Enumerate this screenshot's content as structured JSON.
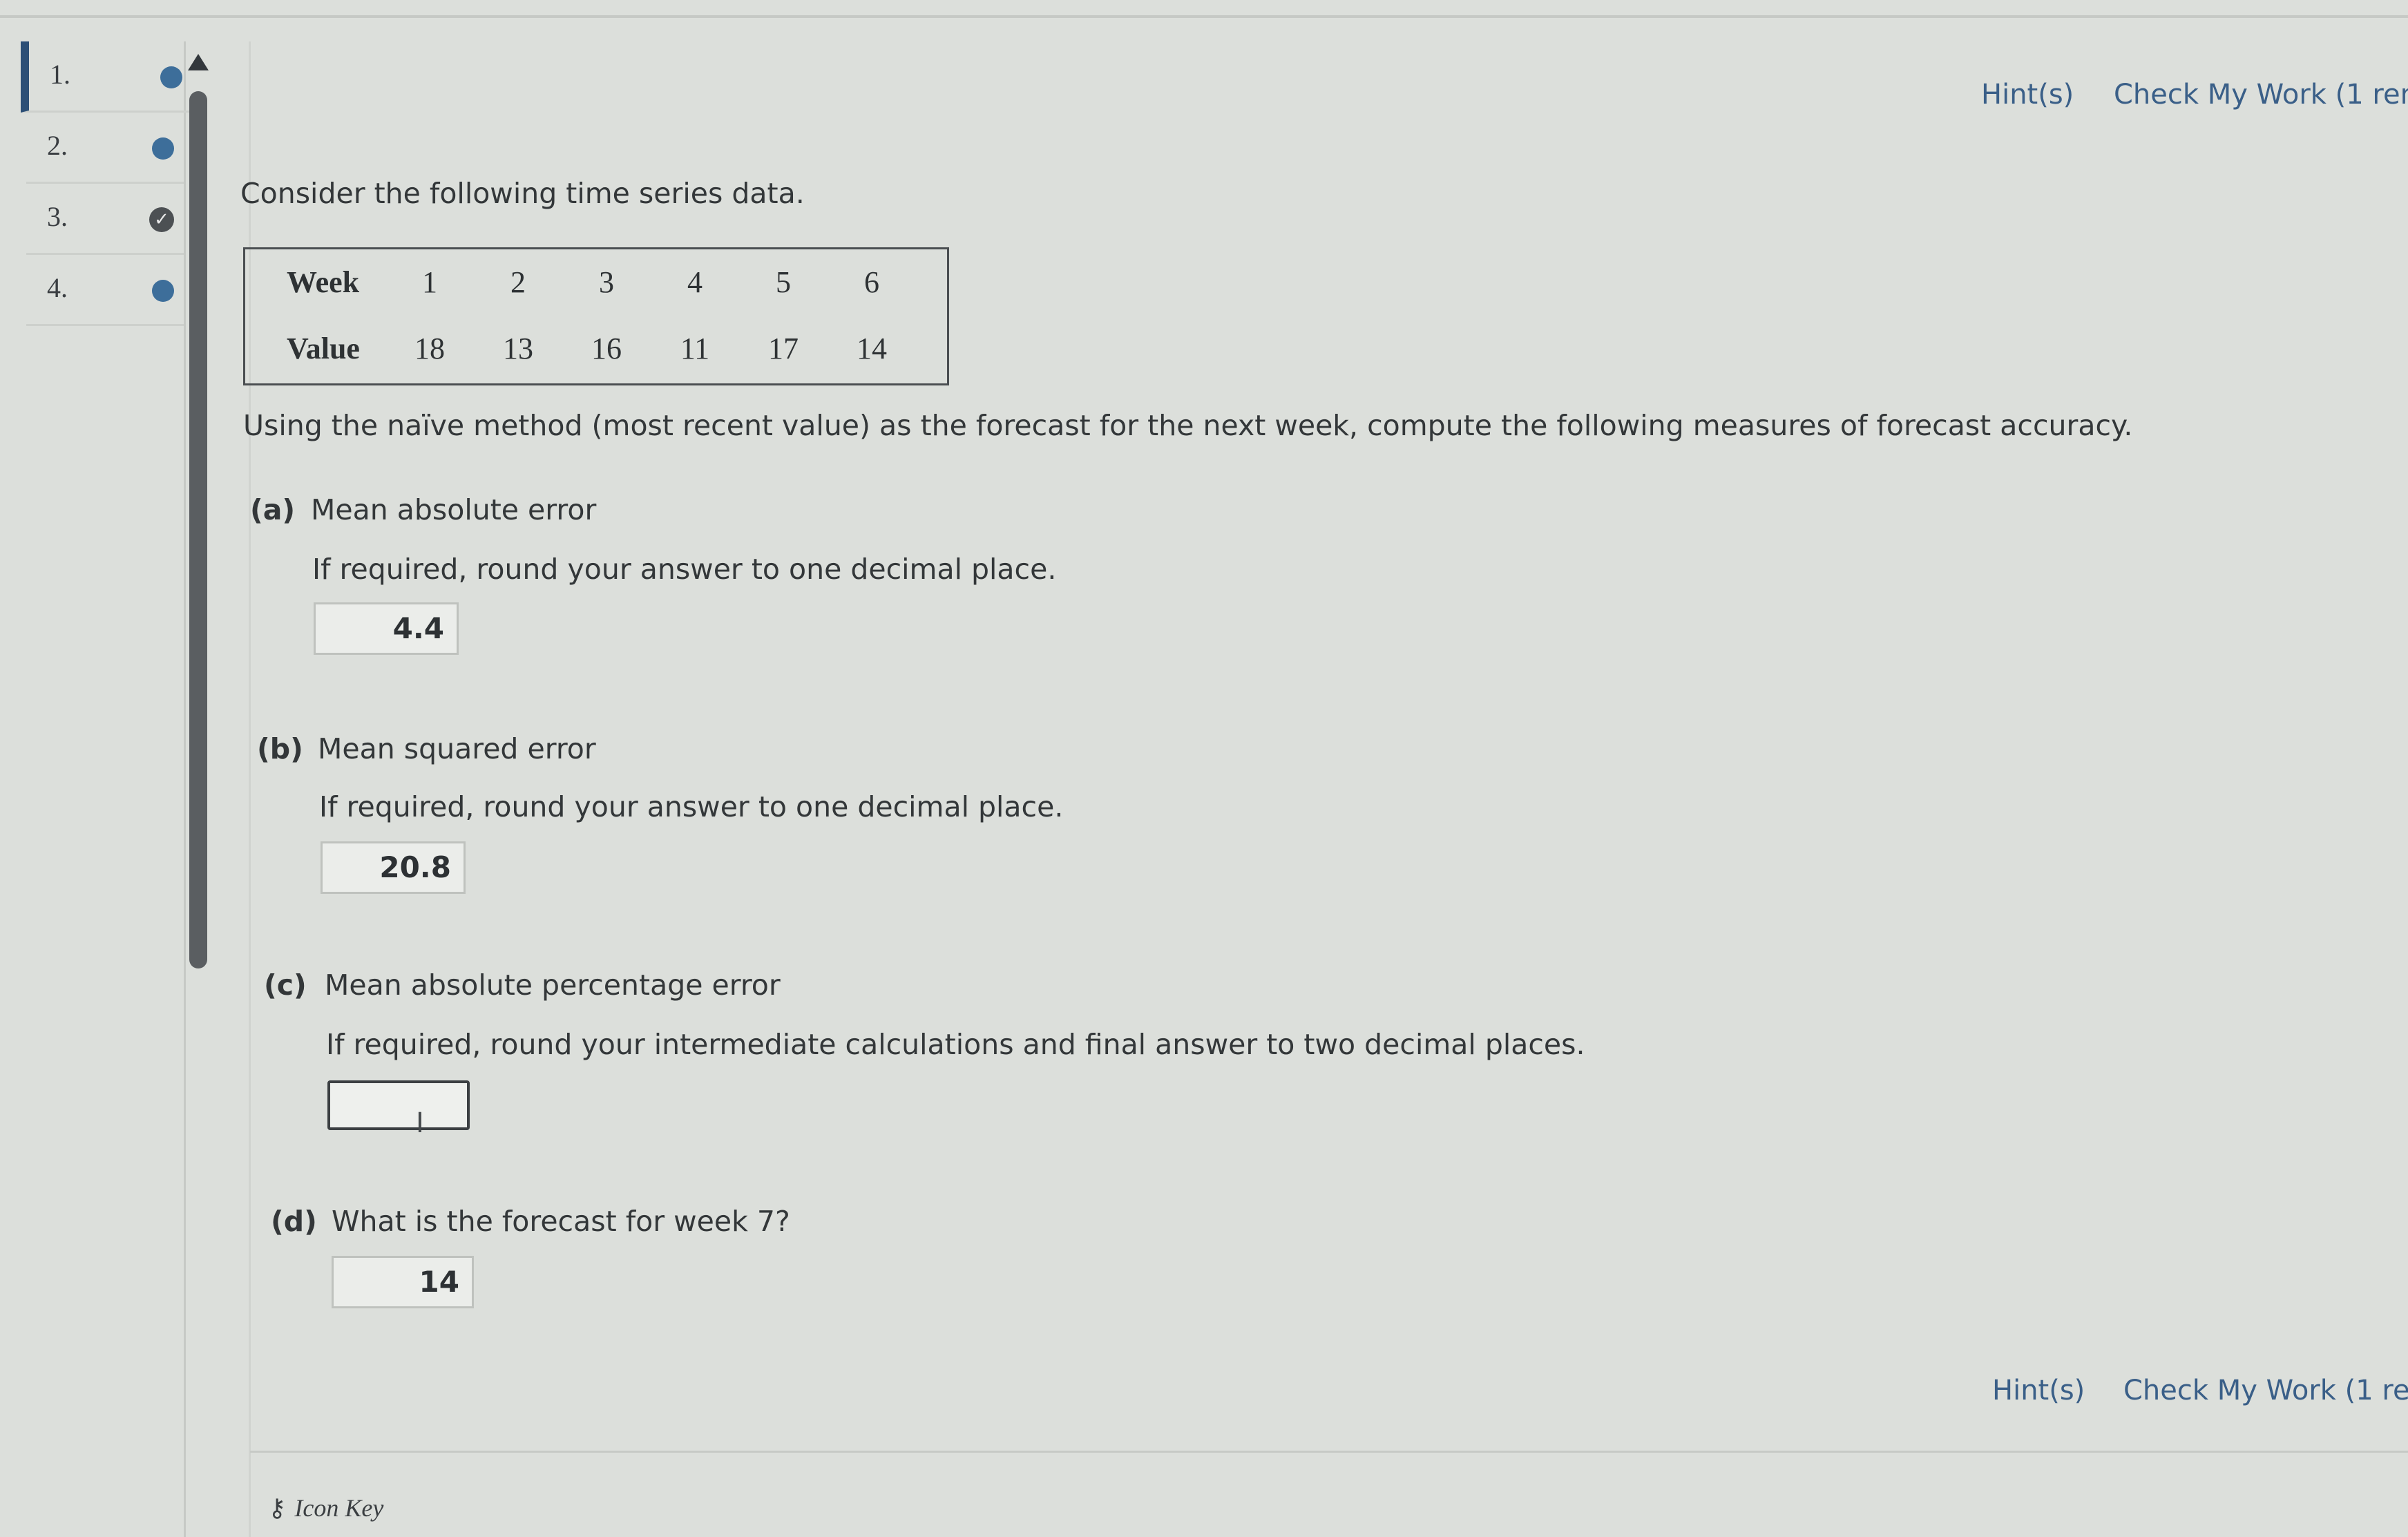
{
  "nav": {
    "items": [
      {
        "label": "1.",
        "status": "dot"
      },
      {
        "label": "2.",
        "status": "dot"
      },
      {
        "label": "3.",
        "status": "check"
      },
      {
        "label": "4.",
        "status": "dot"
      }
    ]
  },
  "header": {
    "hints_label": "Hint(s)",
    "check_label": "Check My Work (1 ren"
  },
  "footer_links": {
    "hints_label": "Hint(s)",
    "check_label": "Check My Work (1 rer"
  },
  "question": {
    "intro": "Consider the following time series data.",
    "table": {
      "row1_label": "Week",
      "weeks": [
        "1",
        "2",
        "3",
        "4",
        "5",
        "6"
      ],
      "row2_label": "Value",
      "values": [
        "18",
        "13",
        "16",
        "11",
        "17",
        "14"
      ]
    },
    "instruction": "Using the naïve method (most recent value) as the forecast for the next week, compute the following measures of forecast accuracy.",
    "parts": {
      "a": {
        "letter": "(a)",
        "title": "Mean absolute error",
        "note": "If required, round your answer to one decimal place.",
        "answer": "4.4"
      },
      "b": {
        "letter": "(b)",
        "title": "Mean squared error",
        "note": "If required, round your answer to one decimal place.",
        "answer": "20.8"
      },
      "c": {
        "letter": "(c)",
        "title": "Mean absolute percentage error",
        "note": "If required, round your intermediate calculations and final answer to two decimal places.",
        "answer": ""
      },
      "d": {
        "letter": "(d)",
        "title": "What is the forecast for week 7?",
        "answer": "14"
      }
    }
  },
  "icon_key": {
    "label": "Icon Key",
    "icon": "key-icon"
  },
  "colors": {
    "link": "#3a5f88",
    "active_marker": "#2c4f76",
    "status_dot": "#3d6e9a"
  }
}
